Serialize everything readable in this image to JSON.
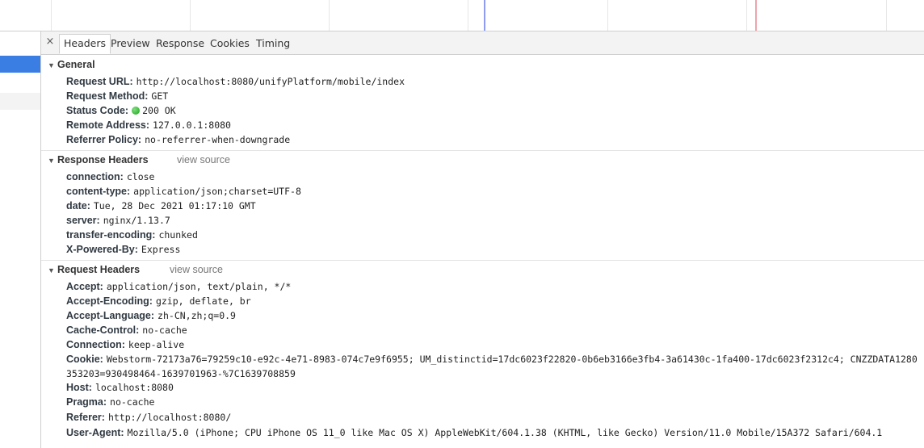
{
  "tabs": {
    "close": "×",
    "items": [
      "Headers",
      "Preview",
      "Response",
      "Cookies",
      "Timing"
    ],
    "active": "Headers"
  },
  "general": {
    "title": "General",
    "fields": [
      {
        "key": "Request URL:",
        "value": "http://localhost:8080/unifyPlatform/mobile/index"
      },
      {
        "key": "Request Method:",
        "value": "GET"
      },
      {
        "key": "Status Code:",
        "value": "200 OK"
      },
      {
        "key": "Remote Address:",
        "value": "127.0.0.1:8080"
      },
      {
        "key": "Referrer Policy:",
        "value": "no-referrer-when-downgrade"
      }
    ]
  },
  "response_headers": {
    "title": "Response Headers",
    "view_source": "view source",
    "fields": [
      {
        "key": "connection:",
        "value": "close"
      },
      {
        "key": "content-type:",
        "value": "application/json;charset=UTF-8"
      },
      {
        "key": "date:",
        "value": "Tue, 28 Dec 2021 01:17:10 GMT"
      },
      {
        "key": "server:",
        "value": "nginx/1.13.7"
      },
      {
        "key": "transfer-encoding:",
        "value": "chunked"
      },
      {
        "key": "X-Powered-By:",
        "value": "Express"
      }
    ]
  },
  "request_headers": {
    "title": "Request Headers",
    "view_source": "view source",
    "fields": [
      {
        "key": "Accept:",
        "value": "application/json, text/plain, */*"
      },
      {
        "key": "Accept-Encoding:",
        "value": "gzip, deflate, br"
      },
      {
        "key": "Accept-Language:",
        "value": "zh-CN,zh;q=0.9"
      },
      {
        "key": "Cache-Control:",
        "value": "no-cache"
      },
      {
        "key": "Connection:",
        "value": "keep-alive"
      },
      {
        "key": "Cookie:",
        "value": "Webstorm-72173a76=79259c10-e92c-4e71-8983-074c7e9f6955; UM_distinctid=17dc6023f22820-0b6eb3166e3fb4-3a61430c-1fa400-17dc6023f2312c4; CNZZDATA1280353203=930498464-1639701963-%7C1639708859"
      },
      {
        "key": "Host:",
        "value": "localhost:8080"
      },
      {
        "key": "Pragma:",
        "value": "no-cache"
      },
      {
        "key": "Referer:",
        "value": "http://localhost:8080/"
      },
      {
        "key": "User-Agent:",
        "value": "Mozilla/5.0 (iPhone; CPU iPhone OS 11_0 like Mac OS X) AppleWebKit/604.1.38 (KHTML, like Gecko) Version/11.0 Mobile/15A372 Safari/604.1"
      }
    ]
  },
  "icons": {
    "collapse": "▼",
    "status_indicator": "green-dot"
  },
  "colors": {
    "selected_row": "#3a7ee4",
    "status_ok": "#1aa11a",
    "timeline_blue": "#8f9cf0",
    "timeline_red": "#f0a3ad"
  }
}
